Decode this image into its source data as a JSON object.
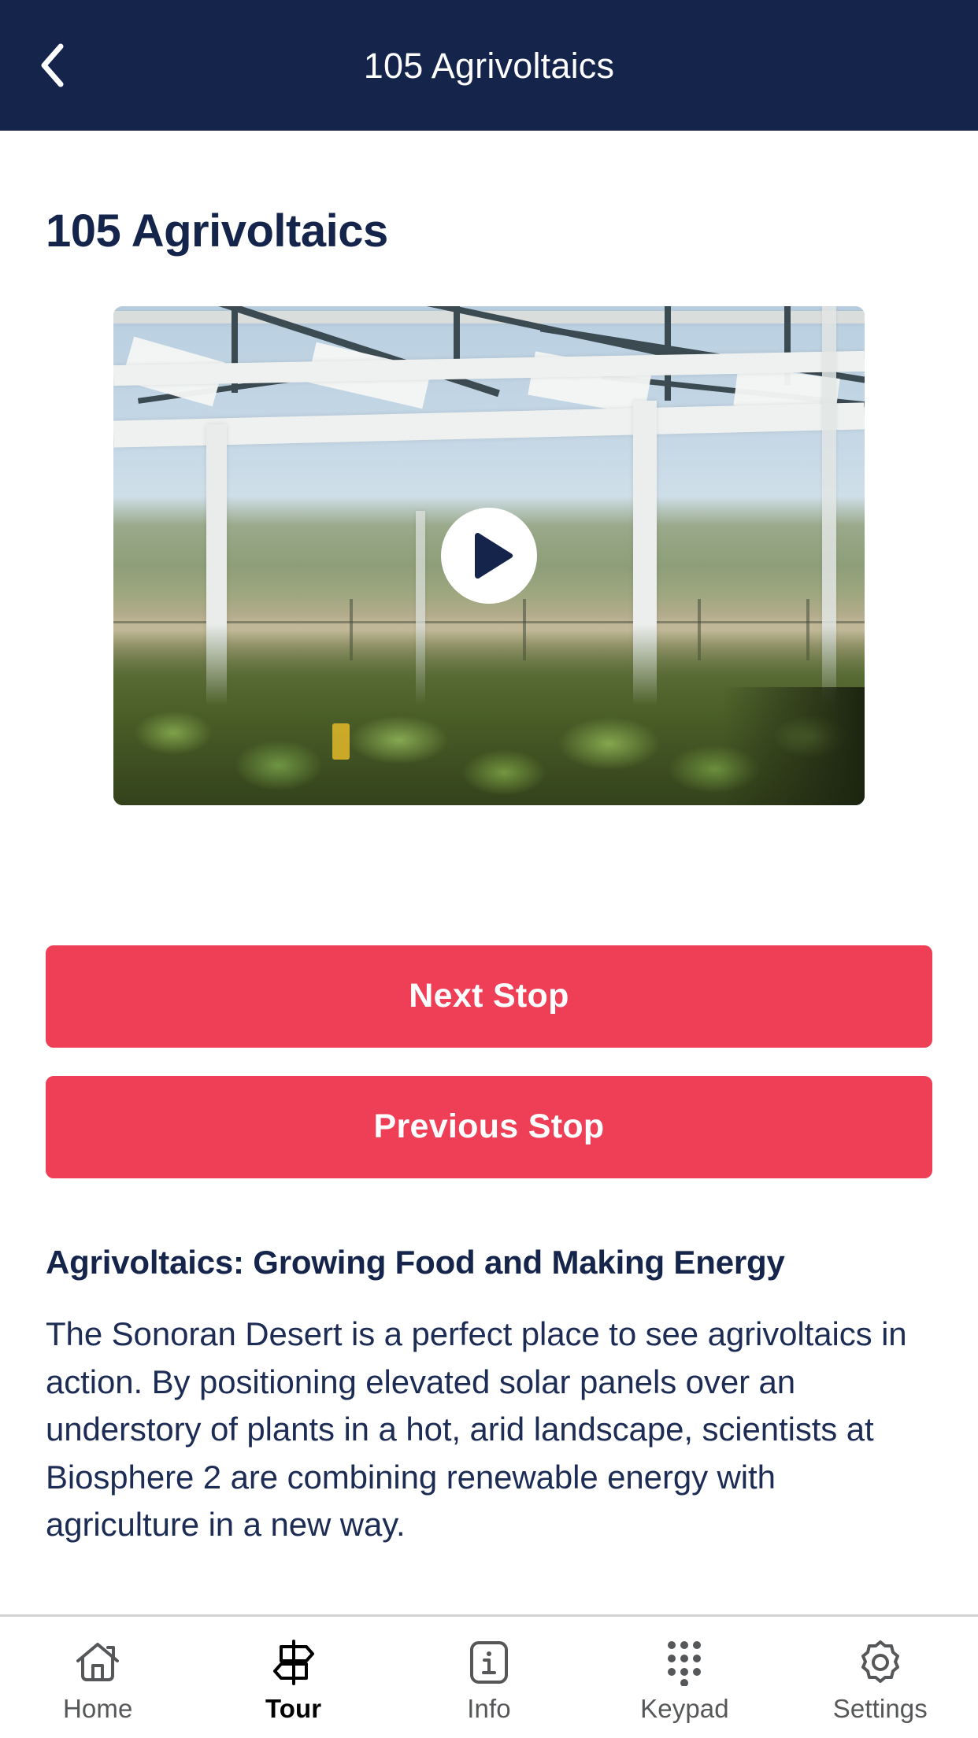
{
  "header": {
    "title": "105 Agrivoltaics",
    "back_icon": "chevron-left-icon",
    "background_color": "#14244b"
  },
  "page": {
    "title": "105 Agrivoltaics"
  },
  "media": {
    "type": "video",
    "play_icon": "play-icon",
    "description": "Elevated white solar panel canopy over rows of leafy green crops in a desert landscape"
  },
  "actions": {
    "next_stop_label": "Next Stop",
    "previous_stop_label": "Previous Stop",
    "accent_color": "#ef3f56"
  },
  "article": {
    "heading": "Agrivoltaics: Growing Food and Making Energy",
    "body": "The Sonoran Desert is a perfect place to see agrivoltaics in action. By positioning elevated solar panels over an understory of plants in a hot, arid landscape, scientists at Biosphere 2 are combining renewable energy with agriculture in a new way."
  },
  "tab_bar": {
    "items": [
      {
        "id": "home",
        "label": "Home",
        "icon": "home-icon",
        "active": false
      },
      {
        "id": "tour",
        "label": "Tour",
        "icon": "signpost-icon",
        "active": true
      },
      {
        "id": "info",
        "label": "Info",
        "icon": "info-icon",
        "active": false
      },
      {
        "id": "keypad",
        "label": "Keypad",
        "icon": "keypad-icon",
        "active": false
      },
      {
        "id": "settings",
        "label": "Settings",
        "icon": "gear-icon",
        "active": false
      }
    ]
  }
}
